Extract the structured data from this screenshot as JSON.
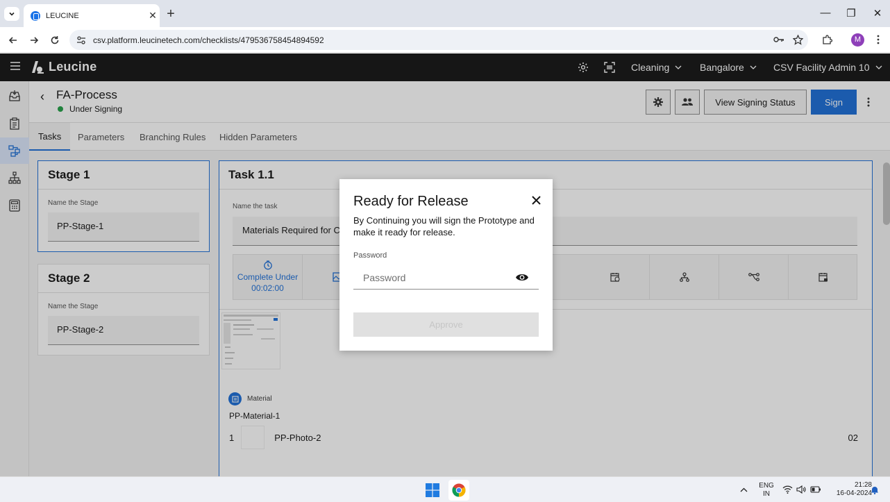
{
  "browser": {
    "tab_title": "LEUCINE",
    "tab_close": "✕",
    "new_tab": "+",
    "url": "csv.platform.leucinetech.com/checklists/479536758454894592",
    "profile_initial": "M",
    "window_controls": [
      "—",
      "❐",
      "✕"
    ]
  },
  "app_header": {
    "brand": "Leucine",
    "facility_dropdowns": [
      "Cleaning",
      "Bangalore",
      "CSV Facility Admin 10"
    ]
  },
  "process": {
    "back_glyph": "‹",
    "name": "FA-Process",
    "status": "Under Signing",
    "status_color": "#24a148",
    "view_signing_status_label": "View Signing Status",
    "sign_label": "Sign"
  },
  "tabs": [
    {
      "label": "Tasks",
      "active": true
    },
    {
      "label": "Parameters"
    },
    {
      "label": "Branching Rules"
    },
    {
      "label": "Hidden Parameters"
    }
  ],
  "stages": [
    {
      "title": "Stage 1",
      "field_label": "Name the Stage",
      "value": "PP-Stage-1"
    },
    {
      "title": "Stage 2",
      "field_label": "Name the Stage",
      "value": "PP-Stage-2"
    }
  ],
  "task": {
    "title": "Task 1.1",
    "field_label": "Name the task",
    "value": "Materials Required for Cleaning",
    "complete_under_label": "Complete Under",
    "complete_under_time": "00:02:00",
    "material_section_label": "Material",
    "material_name": "PP-Material-1",
    "material_row": {
      "index": "1",
      "name": "PP-Photo-2",
      "quantity": "02"
    }
  },
  "modal": {
    "title": "Ready for Release",
    "description": "By Continuing you will sign the Prototype and make it ready for release.",
    "password_label": "Password",
    "password_placeholder": "Password",
    "approve_label": "Approve"
  },
  "taskbar": {
    "lang_top": "ENG",
    "lang_bottom": "IN",
    "time": "21:28",
    "date": "16-04-2024"
  },
  "colors": {
    "accent": "#1d6fd8",
    "header_bg": "#161616",
    "status_green": "#24a148"
  }
}
